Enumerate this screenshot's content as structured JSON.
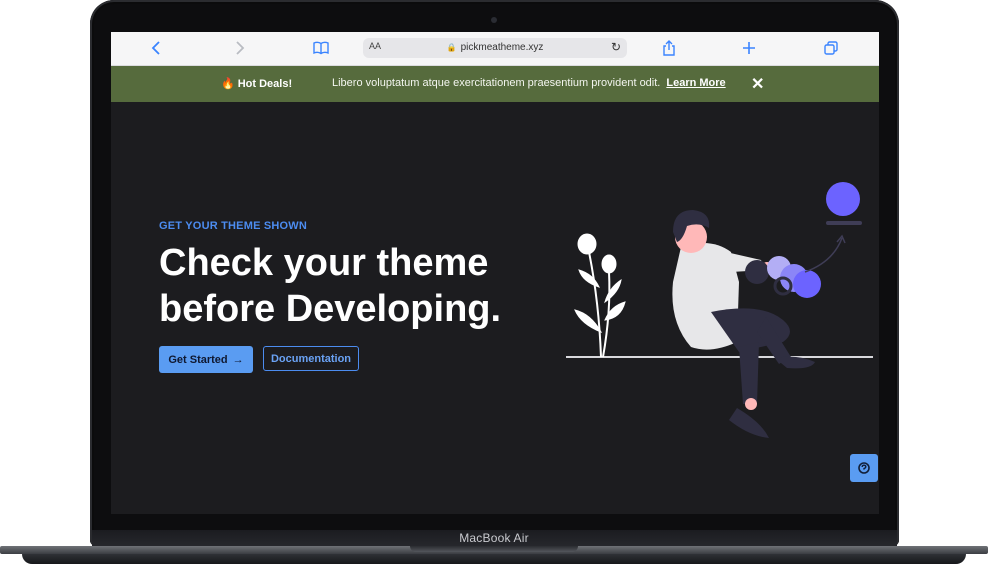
{
  "device": {
    "label": "MacBook Air"
  },
  "browser": {
    "back_icon": "‹",
    "forward_icon": "›",
    "bookmarks_icon": "book-icon",
    "text_size": "AA",
    "url": "pickmeatheme.xyz",
    "share_icon": "share-icon",
    "new_tab_icon": "plus-icon",
    "tabs_icon": "tabs-icon"
  },
  "banner": {
    "badge": "Hot Deals!",
    "message": "Libero voluptatum atque exercitationem praesentium provident odit.",
    "link": "Learn More",
    "close_icon": "✕",
    "color": "#566b3d"
  },
  "hero": {
    "eyebrow": "GET YOUR THEME SHOWN",
    "title_line1": "Check your theme",
    "title_line2": "before Developing.",
    "primary_button": "Get Started",
    "primary_arrow": "→",
    "secondary_button": "Documentation"
  },
  "colors": {
    "accent": "#5a9cf2",
    "background": "#1c1c1f",
    "illustration_accent": "#6c63ff"
  }
}
